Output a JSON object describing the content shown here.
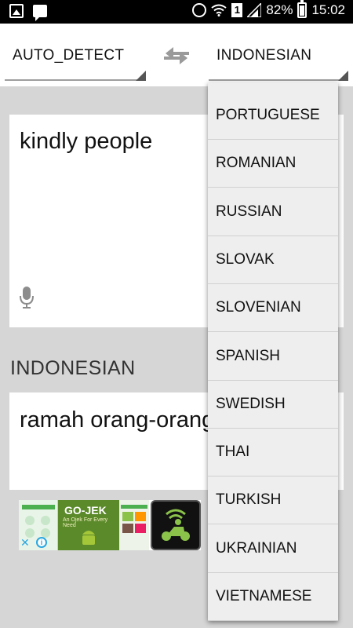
{
  "status_bar": {
    "battery": "82%",
    "time": "15:02",
    "sim": "1",
    "icons": [
      "image-icon",
      "message-icon",
      "alarm-icon",
      "wifi-icon",
      "signal-icon",
      "battery-icon"
    ]
  },
  "language_bar": {
    "source": "AUTO_DETECT",
    "target": "INDONESIAN",
    "swap_icon": "swap-arrows-icon"
  },
  "input": {
    "text": "kindly people",
    "mic_icon": "microphone-icon"
  },
  "result": {
    "label": "INDONESIAN",
    "text": "ramah orang-orang"
  },
  "ad": {
    "brand": "GO-JEK",
    "tagline": "An Ojek For Every Need"
  },
  "dropdown": {
    "items": [
      "PORTUGUESE",
      "ROMANIAN",
      "RUSSIAN",
      "SLOVAK",
      "SLOVENIAN",
      "SPANISH",
      "SWEDISH",
      "THAI",
      "TURKISH",
      "UKRAINIAN",
      "VIETNAMESE"
    ]
  },
  "colors": {
    "background": "#d6d6d6",
    "card": "#ffffff",
    "dropdown": "#eeeeee",
    "ad_accent": "#2aa7e0"
  }
}
